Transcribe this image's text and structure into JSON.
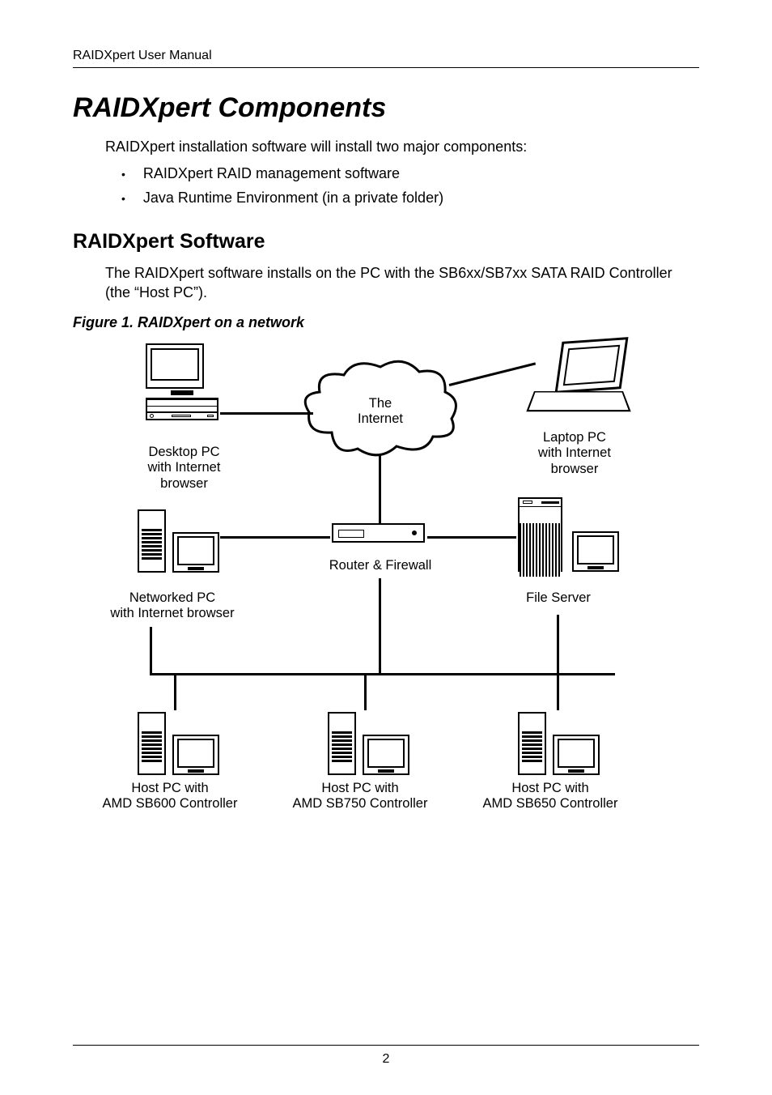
{
  "header": "RAIDXpert User Manual",
  "title": "RAIDXpert Components",
  "intro": "RAIDXpert installation software will install two major components:",
  "bullets": [
    "RAIDXpert RAID management software",
    "Java Runtime Environment (in a private folder)"
  ],
  "section_h2": "RAIDXpert Software",
  "body": "The RAIDXpert software installs on the PC with the SB6xx/SB7xx SATA RAID Controller (the “Host PC”).",
  "figure_caption": "Figure 1.  RAIDXpert on a network",
  "diagram": {
    "cloud_line1": "The",
    "cloud_line2": "Internet",
    "desktop_pc_l1": "Desktop PC",
    "desktop_pc_l2": "with Internet",
    "desktop_pc_l3": "browser",
    "laptop_l1": "Laptop PC",
    "laptop_l2": "with Internet",
    "laptop_l3": "browser",
    "router": "Router & Firewall",
    "networked_l1": "Networked PC",
    "networked_l2": "with Internet browser",
    "fileserver": "File Server",
    "host1_l1": "Host PC with",
    "host1_l2": "AMD SB600 Controller",
    "host2_l1": "Host PC with",
    "host2_l2": "AMD SB750 Controller",
    "host3_l1": "Host PC with",
    "host3_l2": "AMD SB650 Controller"
  },
  "page_number": "2"
}
